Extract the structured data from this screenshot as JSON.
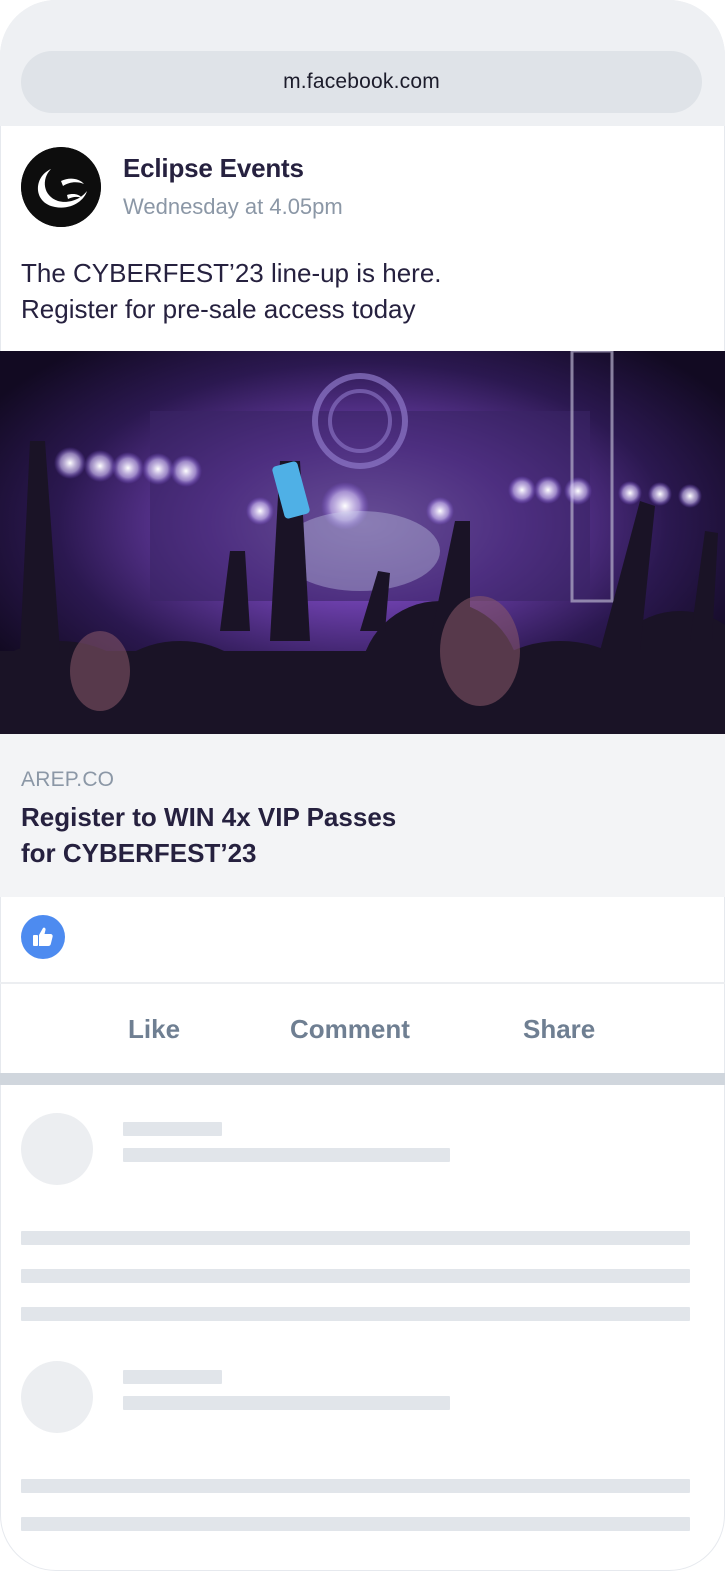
{
  "browser": {
    "url": "m.facebook.com"
  },
  "post": {
    "page_name": "Eclipse Events",
    "timestamp": "Wednesday at 4.05pm",
    "text_lines": [
      "The CYBERFEST’23 line-up is here.",
      "Register for pre-sale access today"
    ],
    "image_icon": "concert-crowd-photo",
    "link": {
      "domain": "AREP.CO",
      "title_lines": [
        "Register to WIN 4x VIP Passes",
        "for CYBERFEST’23"
      ]
    },
    "reactions": {
      "icon": "thumbs-up-icon"
    },
    "actions": {
      "like": "Like",
      "comment": "Comment",
      "share": "Share"
    }
  },
  "colors": {
    "text_dark": "#26213f",
    "text_muted": "#8b97a6",
    "like_blue": "#4d8bf0",
    "skeleton": "#e1e5ea"
  }
}
